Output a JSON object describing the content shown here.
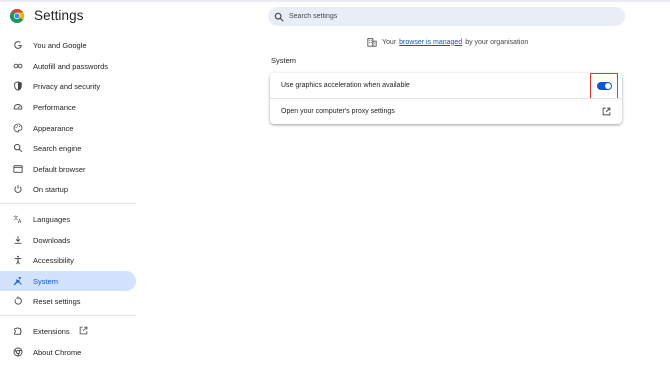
{
  "app": {
    "title": "Settings"
  },
  "search": {
    "placeholder": "Search settings"
  },
  "sidebar": {
    "items": [
      {
        "label": "You and Google",
        "icon": "google-g-icon"
      },
      {
        "label": "Autofill and passwords",
        "icon": "key-icon"
      },
      {
        "label": "Privacy and security",
        "icon": "shield-icon"
      },
      {
        "label": "Performance",
        "icon": "speedometer-icon"
      },
      {
        "label": "Appearance",
        "icon": "palette-icon"
      },
      {
        "label": "Search engine",
        "icon": "search-icon"
      },
      {
        "label": "Default browser",
        "icon": "browser-window-icon"
      },
      {
        "label": "On startup",
        "icon": "power-icon"
      },
      {
        "label": "Languages",
        "icon": "translate-icon"
      },
      {
        "label": "Downloads",
        "icon": "download-icon"
      },
      {
        "label": "Accessibility",
        "icon": "accessibility-icon"
      },
      {
        "label": "System",
        "icon": "wrench-icon",
        "active": true
      },
      {
        "label": "Reset settings",
        "icon": "reset-icon"
      },
      {
        "label": "Extensions",
        "icon": "puzzle-icon"
      },
      {
        "label": "About Chrome",
        "icon": "chrome-icon"
      }
    ]
  },
  "managed_notice": {
    "prefix": "Your",
    "link": "browser is managed",
    "suffix": "by your organisation"
  },
  "main": {
    "section_title": "System",
    "rows": [
      {
        "label": "Use graphics acceleration when available",
        "toggle_on": true
      },
      {
        "label": "Open your computer's proxy settings"
      }
    ]
  },
  "colors": {
    "accent": "#0b57d0",
    "active_bg": "#d3e3fd",
    "search_bg": "#e9eef6",
    "highlight_border": "#e3342f"
  }
}
